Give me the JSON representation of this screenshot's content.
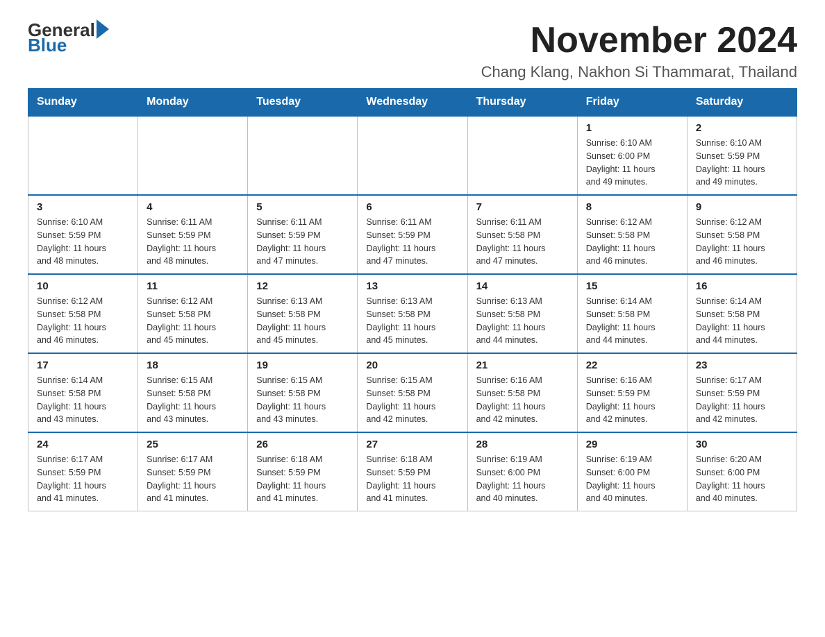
{
  "header": {
    "logo_general": "General",
    "logo_blue": "Blue",
    "month_title": "November 2024",
    "location": "Chang Klang, Nakhon Si Thammarat, Thailand"
  },
  "weekdays": [
    "Sunday",
    "Monday",
    "Tuesday",
    "Wednesday",
    "Thursday",
    "Friday",
    "Saturday"
  ],
  "weeks": [
    [
      {
        "day": "",
        "info": ""
      },
      {
        "day": "",
        "info": ""
      },
      {
        "day": "",
        "info": ""
      },
      {
        "day": "",
        "info": ""
      },
      {
        "day": "",
        "info": ""
      },
      {
        "day": "1",
        "info": "Sunrise: 6:10 AM\nSunset: 6:00 PM\nDaylight: 11 hours\nand 49 minutes."
      },
      {
        "day": "2",
        "info": "Sunrise: 6:10 AM\nSunset: 5:59 PM\nDaylight: 11 hours\nand 49 minutes."
      }
    ],
    [
      {
        "day": "3",
        "info": "Sunrise: 6:10 AM\nSunset: 5:59 PM\nDaylight: 11 hours\nand 48 minutes."
      },
      {
        "day": "4",
        "info": "Sunrise: 6:11 AM\nSunset: 5:59 PM\nDaylight: 11 hours\nand 48 minutes."
      },
      {
        "day": "5",
        "info": "Sunrise: 6:11 AM\nSunset: 5:59 PM\nDaylight: 11 hours\nand 47 minutes."
      },
      {
        "day": "6",
        "info": "Sunrise: 6:11 AM\nSunset: 5:59 PM\nDaylight: 11 hours\nand 47 minutes."
      },
      {
        "day": "7",
        "info": "Sunrise: 6:11 AM\nSunset: 5:58 PM\nDaylight: 11 hours\nand 47 minutes."
      },
      {
        "day": "8",
        "info": "Sunrise: 6:12 AM\nSunset: 5:58 PM\nDaylight: 11 hours\nand 46 minutes."
      },
      {
        "day": "9",
        "info": "Sunrise: 6:12 AM\nSunset: 5:58 PM\nDaylight: 11 hours\nand 46 minutes."
      }
    ],
    [
      {
        "day": "10",
        "info": "Sunrise: 6:12 AM\nSunset: 5:58 PM\nDaylight: 11 hours\nand 46 minutes."
      },
      {
        "day": "11",
        "info": "Sunrise: 6:12 AM\nSunset: 5:58 PM\nDaylight: 11 hours\nand 45 minutes."
      },
      {
        "day": "12",
        "info": "Sunrise: 6:13 AM\nSunset: 5:58 PM\nDaylight: 11 hours\nand 45 minutes."
      },
      {
        "day": "13",
        "info": "Sunrise: 6:13 AM\nSunset: 5:58 PM\nDaylight: 11 hours\nand 45 minutes."
      },
      {
        "day": "14",
        "info": "Sunrise: 6:13 AM\nSunset: 5:58 PM\nDaylight: 11 hours\nand 44 minutes."
      },
      {
        "day": "15",
        "info": "Sunrise: 6:14 AM\nSunset: 5:58 PM\nDaylight: 11 hours\nand 44 minutes."
      },
      {
        "day": "16",
        "info": "Sunrise: 6:14 AM\nSunset: 5:58 PM\nDaylight: 11 hours\nand 44 minutes."
      }
    ],
    [
      {
        "day": "17",
        "info": "Sunrise: 6:14 AM\nSunset: 5:58 PM\nDaylight: 11 hours\nand 43 minutes."
      },
      {
        "day": "18",
        "info": "Sunrise: 6:15 AM\nSunset: 5:58 PM\nDaylight: 11 hours\nand 43 minutes."
      },
      {
        "day": "19",
        "info": "Sunrise: 6:15 AM\nSunset: 5:58 PM\nDaylight: 11 hours\nand 43 minutes."
      },
      {
        "day": "20",
        "info": "Sunrise: 6:15 AM\nSunset: 5:58 PM\nDaylight: 11 hours\nand 42 minutes."
      },
      {
        "day": "21",
        "info": "Sunrise: 6:16 AM\nSunset: 5:58 PM\nDaylight: 11 hours\nand 42 minutes."
      },
      {
        "day": "22",
        "info": "Sunrise: 6:16 AM\nSunset: 5:59 PM\nDaylight: 11 hours\nand 42 minutes."
      },
      {
        "day": "23",
        "info": "Sunrise: 6:17 AM\nSunset: 5:59 PM\nDaylight: 11 hours\nand 42 minutes."
      }
    ],
    [
      {
        "day": "24",
        "info": "Sunrise: 6:17 AM\nSunset: 5:59 PM\nDaylight: 11 hours\nand 41 minutes."
      },
      {
        "day": "25",
        "info": "Sunrise: 6:17 AM\nSunset: 5:59 PM\nDaylight: 11 hours\nand 41 minutes."
      },
      {
        "day": "26",
        "info": "Sunrise: 6:18 AM\nSunset: 5:59 PM\nDaylight: 11 hours\nand 41 minutes."
      },
      {
        "day": "27",
        "info": "Sunrise: 6:18 AM\nSunset: 5:59 PM\nDaylight: 11 hours\nand 41 minutes."
      },
      {
        "day": "28",
        "info": "Sunrise: 6:19 AM\nSunset: 6:00 PM\nDaylight: 11 hours\nand 40 minutes."
      },
      {
        "day": "29",
        "info": "Sunrise: 6:19 AM\nSunset: 6:00 PM\nDaylight: 11 hours\nand 40 minutes."
      },
      {
        "day": "30",
        "info": "Sunrise: 6:20 AM\nSunset: 6:00 PM\nDaylight: 11 hours\nand 40 minutes."
      }
    ]
  ]
}
